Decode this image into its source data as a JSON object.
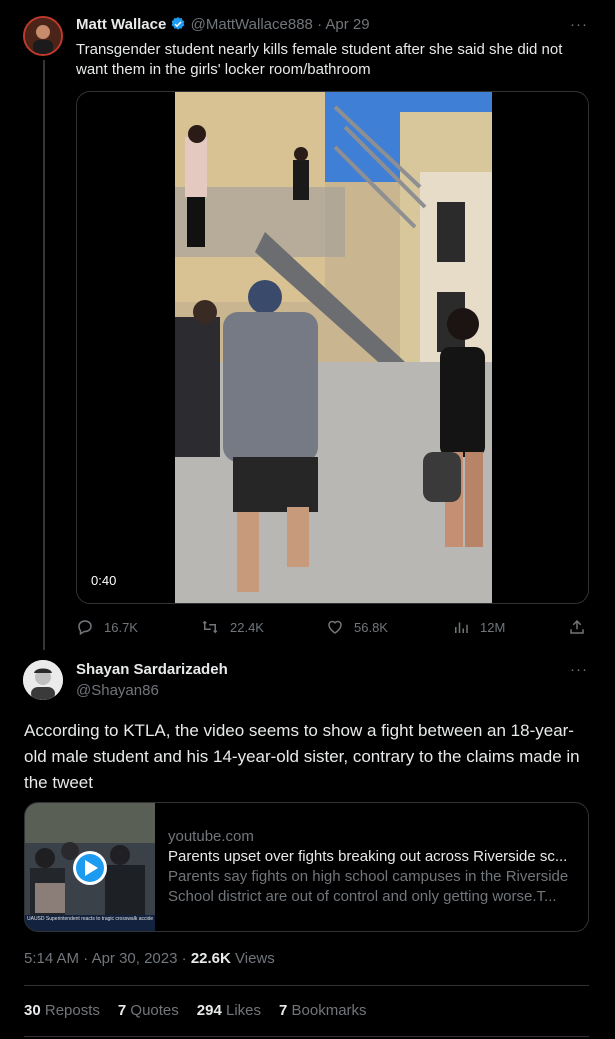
{
  "quoted_tweet": {
    "author_name": "Matt Wallace",
    "handle": "@MattWallace888",
    "separator": "·",
    "date": "Apr 29",
    "more": "···",
    "text": "Transgender student nearly kills female student after she said she did not want them in the girls' locker room/bathroom",
    "video_duration": "0:40",
    "actions": {
      "replies": "16.7K",
      "reposts": "22.4K",
      "likes": "56.8K",
      "views": "12M"
    }
  },
  "main_tweet": {
    "author_name": "Shayan Sardarizadeh",
    "handle": "@Shayan86",
    "more": "···",
    "text": "According to KTLA, the video seems to show a fight between an 18-year-old male student and his 14-year-old sister, contrary to the claims made in the tweet",
    "link_card": {
      "domain": "youtube.com",
      "title": "Parents upset over fights breaking out across Riverside sc...",
      "description": "Parents say fights on high school campuses in the Riverside School district are out of control and only getting worse.T...",
      "thumb_caption": "UAUSD Superintendent reacts to tragic crosswalk accident th"
    },
    "time": "5:14 AM",
    "date": "Apr 30, 2023",
    "separator": "·",
    "views_count": "22.6K",
    "views_label": "Views",
    "stats": {
      "reposts_count": "30",
      "reposts_label": "Reposts",
      "quotes_count": "7",
      "quotes_label": "Quotes",
      "likes_count": "294",
      "likes_label": "Likes",
      "bookmarks_count": "7",
      "bookmarks_label": "Bookmarks"
    }
  },
  "colors": {
    "background": "#000000",
    "text": "#e7e9ea",
    "muted": "#71767b",
    "border": "#2f3336",
    "verified": "#1d9bf0",
    "play": "#1d9bf0"
  },
  "icons": [
    "verified-badge-icon",
    "more-icon",
    "reply-icon",
    "repost-icon",
    "like-icon",
    "views-icon",
    "share-icon",
    "play-icon"
  ]
}
